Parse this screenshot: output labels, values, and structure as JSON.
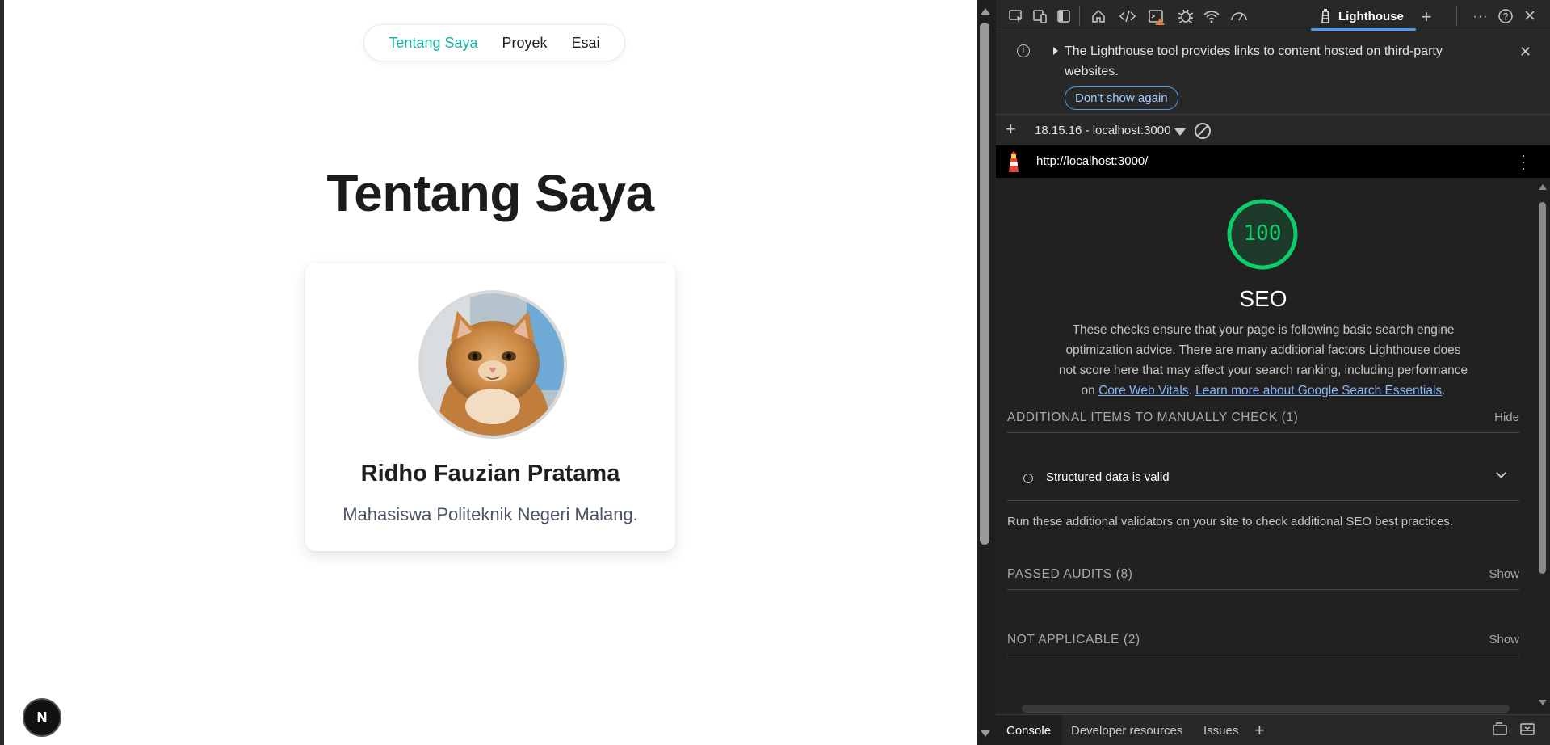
{
  "page": {
    "nav": {
      "items": [
        "Tentang Saya",
        "Proyek",
        "Esai"
      ],
      "active_index": 0
    },
    "title": "Tentang Saya",
    "profile": {
      "name": "Ridho Fauzian Pratama",
      "description": "Mahasiswa Politeknik Negeri Malang."
    },
    "badge": "N"
  },
  "devtools": {
    "toolbar": {
      "icons": [
        "inspect-icon",
        "device-emulation-icon",
        "dock-icon",
        "welcome-home-icon",
        "elements-icon",
        "console-icon",
        "sources-icon",
        "network-icon",
        "performance-icon"
      ],
      "active_tab": "Lighthouse"
    },
    "infobar": {
      "message": "The Lighthouse tool provides links to content hosted on third-party websites.",
      "button": "Don't show again"
    },
    "run_selector": "18.15.16 - localhost:3000",
    "url": "http://localhost:3000/",
    "report": {
      "score": "100",
      "score_fraction": 1.0,
      "score_color": "#0cce6b",
      "category": "SEO",
      "description_text": "These checks ensure that your page is following basic search engine optimization advice. There are many additional factors Lighthouse does not score here that may affect your search ranking, including performance on ",
      "link_cwv": "Core Web Vitals",
      "link_sep": ". ",
      "link_learn": "Learn more about Google Search Essentials",
      "desc_end": ".",
      "groups": {
        "manual": {
          "title": "ADDITIONAL ITEMS TO MANUALLY CHECK (1)",
          "action": "Hide"
        },
        "passed": {
          "title": "PASSED AUDITS (8)",
          "action": "Show"
        },
        "na": {
          "title": "NOT APPLICABLE (2)",
          "action": "Show"
        }
      },
      "manual_audit": "Structured data is valid",
      "manual_desc": "Run these additional validators on your site to check additional SEO best practices."
    },
    "drawer": {
      "tabs": [
        "Console",
        "Developer resources",
        "Issues"
      ],
      "active": "Console"
    }
  }
}
